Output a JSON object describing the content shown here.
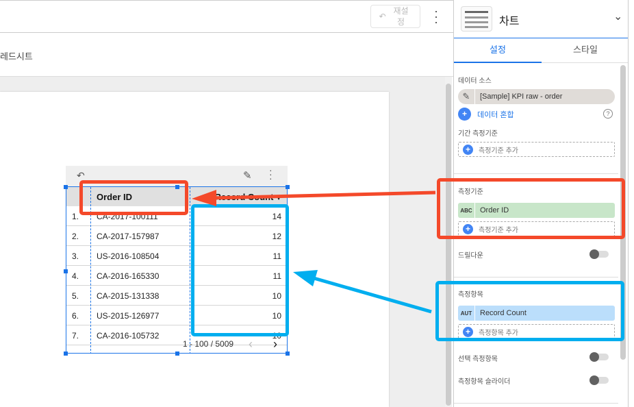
{
  "toolbar": {
    "reset_label": "재설정",
    "reset_icon": "undo-icon",
    "more_icon": "more-vert-icon"
  },
  "subbar": {
    "text": "레드시트"
  },
  "table": {
    "headers": [
      "Order ID",
      "Record Count"
    ],
    "sort_indicator": "▼",
    "rows": [
      {
        "index": "1.",
        "order_id": "CA-2017-100111",
        "count": "14"
      },
      {
        "index": "2.",
        "order_id": "CA-2017-157987",
        "count": "12"
      },
      {
        "index": "3.",
        "order_id": "US-2016-108504",
        "count": "11"
      },
      {
        "index": "4.",
        "order_id": "CA-2016-165330",
        "count": "11"
      },
      {
        "index": "5.",
        "order_id": "CA-2015-131338",
        "count": "10"
      },
      {
        "index": "6.",
        "order_id": "US-2015-126977",
        "count": "10"
      },
      {
        "index": "7.",
        "order_id": "CA-2016-105732",
        "count": "10"
      }
    ],
    "pagination": "1 - 100 / 5009",
    "prev": "‹",
    "next": "›"
  },
  "panel": {
    "title": "차트",
    "tabs": [
      "설정",
      "스타일"
    ],
    "active_tab": "설정",
    "data_source_label": "데이터 소스",
    "data_source": "[Sample] KPI raw - order",
    "blend_label": "데이터 혼합",
    "date_dimension_label": "기간 측정기준",
    "add_dimension": "측정기준 추가",
    "dimension_label": "측정기준",
    "dimension_type": "ABC",
    "dimension": "Order ID",
    "drilldown_label": "드릴다운",
    "metric_label": "측정항목",
    "metric_type": "AUT",
    "metric": "Record Count",
    "add_metric": "측정항목 추가",
    "optional_metrics_label": "선택 측정항목",
    "metric_slider_label": "측정항목 슬라이더",
    "toggles": {
      "drilldown": false,
      "optional_metrics": false,
      "metric_slider": false
    }
  },
  "colors": {
    "accent": "#1a73e8",
    "annotation_red": "#f4492a",
    "annotation_blue": "#00aeef",
    "dimension_chip": "#c8e6c9",
    "metric_chip": "#bbdefb"
  }
}
